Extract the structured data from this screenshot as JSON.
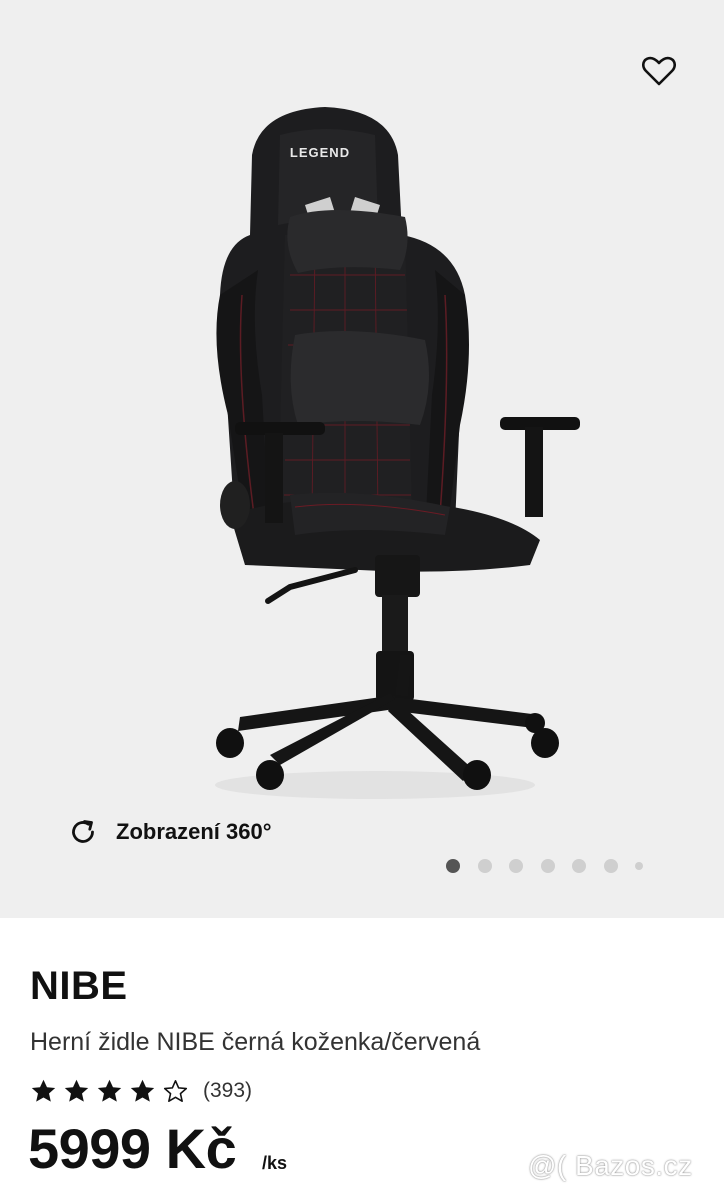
{
  "gallery": {
    "favorite_icon": "heart-outline-icon",
    "chair_logo_text": "LEGEND",
    "view360": {
      "icon": "rotate-icon",
      "label": "Zobrazení 360°"
    },
    "dots": {
      "count": 7,
      "active_index": 0
    }
  },
  "product": {
    "brand": "NIBE",
    "description": "Herní židle NIBE černá koženka/červená",
    "rating": {
      "stars": 4,
      "max": 5,
      "count_text": "(393)"
    },
    "price": "5999 Kč",
    "unit": "/ks"
  },
  "watermark": "@( Bazos.cz",
  "colors": {
    "background": "#efefef",
    "text": "#111111",
    "dot_active": "#555555",
    "dot_inactive": "#cfcfcf",
    "chair_stitch": "#7a1f2a"
  }
}
